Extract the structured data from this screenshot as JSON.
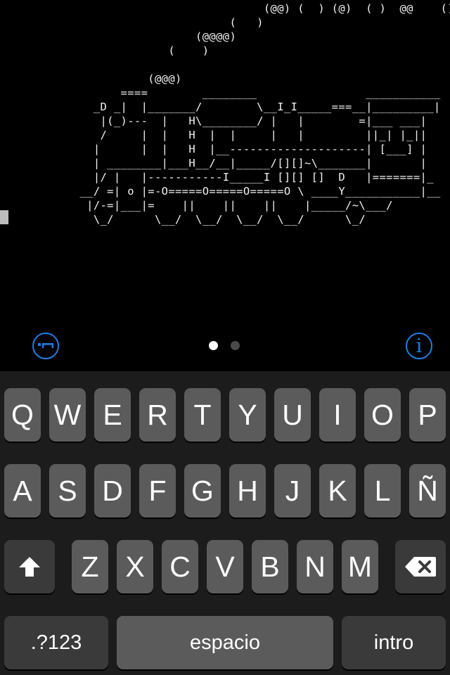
{
  "terminal": {
    "ascii_art": "                                   (@@) (  ) (@)  ( )  @@    ()\n                              (   )\n                         (@@@@)\n                     (    )\n\n                  (@@@)\n              ====        ________                ___________\n          _D _|  |_______/        \\__I_I_____===__|_________|\n           |(_)---  |   H\\________/ |   |        =|___ ___|\n           /     |  |   H  |  |     |   |         ||_| |_||\n          |      |  |   H  |__--------------------| [___] |\n          | ________|___H__/__|_____/[][]~\\_______|       |\n          |/ |   |-----------I_____I [][] []  D   |=======|_\n        __/ =| o |=-O=====O=====O=====O \\ ____Y___________|__\n         |/-=|___|=    ||    ||    ||    |_____/~\\___/\n          \\_/      \\__/  \\__/  \\__/  \\__/      \\_/"
  },
  "toolbar": {
    "keyboard_icon": "keyboard-icon",
    "info_icon": "info-icon",
    "info_glyph": "i",
    "page_count": 2,
    "active_page": 1
  },
  "colors": {
    "accent": "#1a7fe8",
    "dot_active": "#ffffff",
    "dot_inactive": "#4a4a4a"
  },
  "keyboard": {
    "row1": [
      "Q",
      "W",
      "E",
      "R",
      "T",
      "Y",
      "U",
      "I",
      "O",
      "P"
    ],
    "row2": [
      "A",
      "S",
      "D",
      "F",
      "G",
      "H",
      "J",
      "K",
      "L",
      "Ñ"
    ],
    "row3": [
      "Z",
      "X",
      "C",
      "V",
      "B",
      "N",
      "M"
    ],
    "shift_icon": "shift-arrow-icon",
    "backspace_icon": "backspace-icon",
    "numbers_label": ".?123",
    "space_label": "espacio",
    "return_label": "intro"
  }
}
